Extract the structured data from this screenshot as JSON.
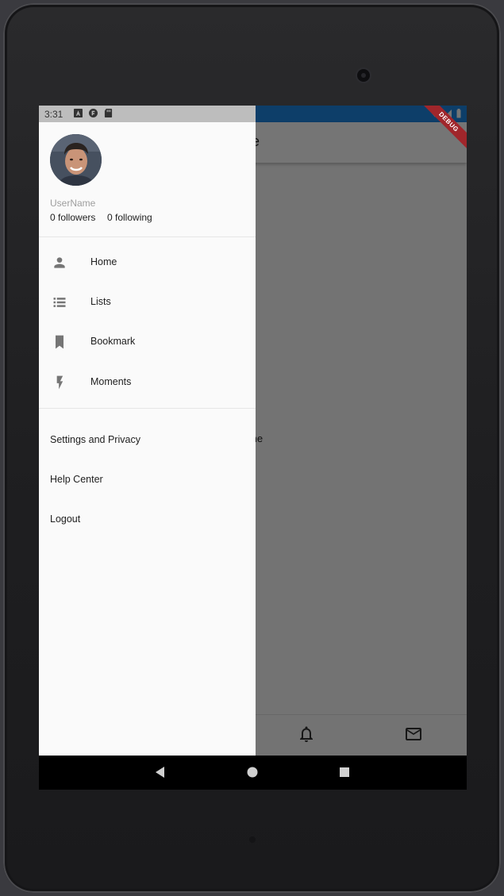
{
  "status_bar": {
    "time": "3:31",
    "icons": [
      "a-notification-icon",
      "flutter-notification-icon",
      "sd-card-icon"
    ],
    "right_icons": [
      "wifi-icon",
      "signal-icon",
      "battery-icon"
    ]
  },
  "app": {
    "appbar_title": "me",
    "body_text": "me",
    "bottom_nav": [
      "notifications-icon",
      "mail-icon"
    ],
    "debug_banner": "DEBUG"
  },
  "drawer": {
    "username": "UserName",
    "followers": "0 followers",
    "following": "0 following",
    "menu": [
      {
        "label": "Home",
        "icon": "person-icon"
      },
      {
        "label": "Lists",
        "icon": "list-icon"
      },
      {
        "label": "Bookmark",
        "icon": "bookmark-icon"
      },
      {
        "label": "Moments",
        "icon": "bolt-icon"
      }
    ],
    "secondary": [
      {
        "label": "Settings and Privacy"
      },
      {
        "label": "Help Center"
      },
      {
        "label": "Logout"
      }
    ]
  },
  "system_nav": [
    "back-icon",
    "home-icon",
    "recents-icon"
  ],
  "colors": {
    "drawer_bg": "#fafafa",
    "statusbar_drawer": "#bdbdbd",
    "scrim": "rgba(0,0,0,0.54)",
    "icon_gray": "#757575",
    "debug_red": "#a0262b"
  }
}
